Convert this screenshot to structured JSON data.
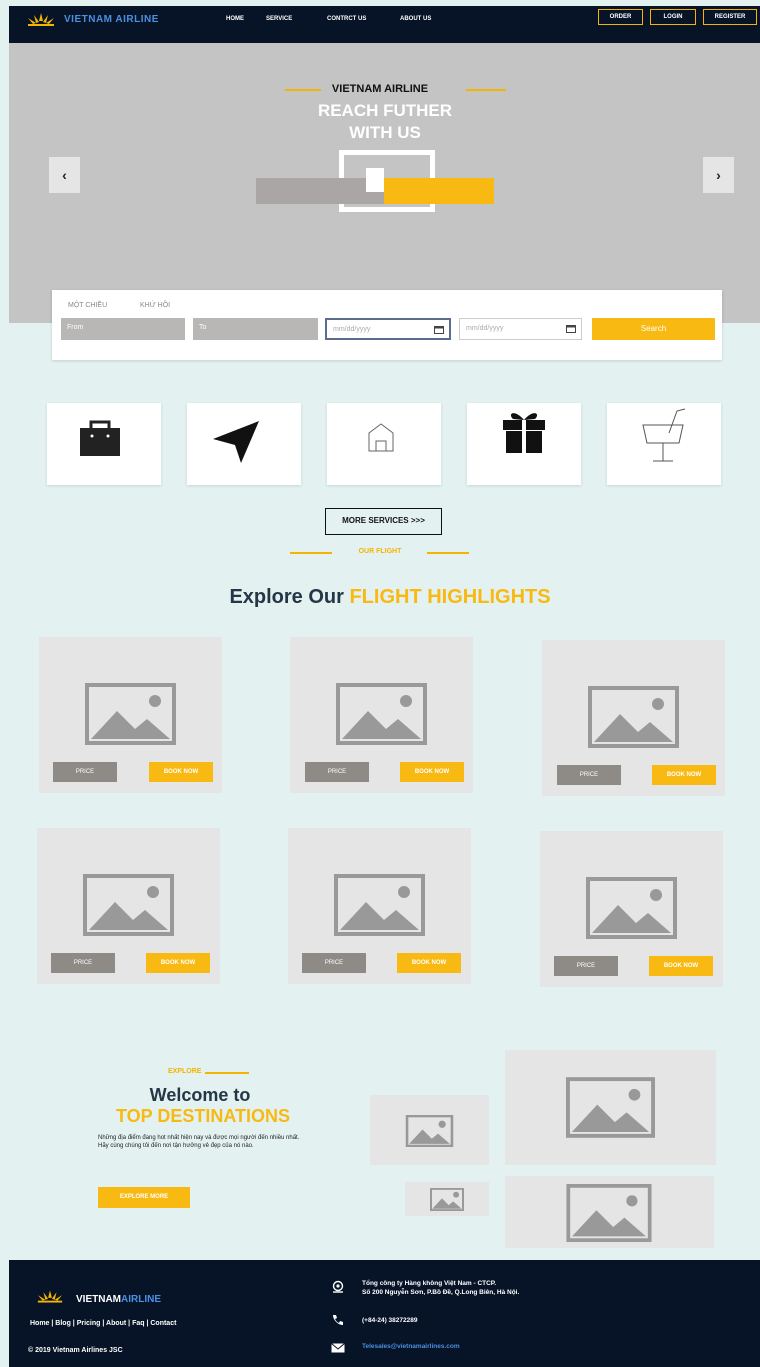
{
  "header": {
    "logo_text": "VIETNAM AIRLINE",
    "nav": [
      "HOME",
      "SERVICE",
      "CONTRCT US",
      "ABOUT US"
    ],
    "buttons": [
      "ORDER",
      "LOGIN",
      "REGISTER"
    ]
  },
  "hero": {
    "kicker": "VIETNAM AIRLINE",
    "title_line1": "REACH FUTHER",
    "title_line2": "WITH US",
    "prev": "‹",
    "next": "›"
  },
  "search": {
    "trip_options": [
      "MỘT CHIỀU",
      "KHỨ HỒI"
    ],
    "from_placeholder": "From",
    "to_placeholder": "To",
    "depart_placeholder": "mm/dd/yyyy",
    "return_placeholder": "mm/dd/yyyy",
    "button": "Search"
  },
  "services": {
    "items": [
      "bag-icon",
      "send-icon",
      "house-icon",
      "gift-icon",
      "drink-icon"
    ],
    "more_button": "MORE SERVICES >>>"
  },
  "flights": {
    "kicker": "OUR FLIGHT",
    "title_part1": "Explore Our ",
    "title_part2": "FLIGHT HIGHLIGHTS",
    "price_label": "PRICE",
    "book_label": "BOOK NOW"
  },
  "destinations": {
    "kicker": "EXPLORE",
    "title_line1": "Welcome to",
    "title_line2": "TOP DESTINATIONS",
    "description": "Những địa điểm đang hot nhất hiện nay và được mọi người đến nhiều nhất. Hãy cùng chúng tôi đến nơi tận hưởng vẻ đẹp của nó nào.",
    "button": "EXPLORE MORE"
  },
  "footer": {
    "logo_part1": "VIETNAM",
    "logo_part2": "AIRLINE",
    "links": "Home | Blog | Pricing | About | Faq | Contact",
    "copyright": "© 2019 Vietnam Airlines JSC",
    "address_line1": "Tổng công ty Hàng không Việt Nam - CTCP.",
    "address_line2": "Số 200 Nguyễn Sơn, P.Bồ Đề, Q.Long Biên, Hà Nội.",
    "phone": "(+84-24) 38272289",
    "email": "Telesales@vietnamairlines.com"
  },
  "colors": {
    "accent": "#f8b912",
    "header_bg": "#071427",
    "page_bg": "#e3f2f1"
  }
}
